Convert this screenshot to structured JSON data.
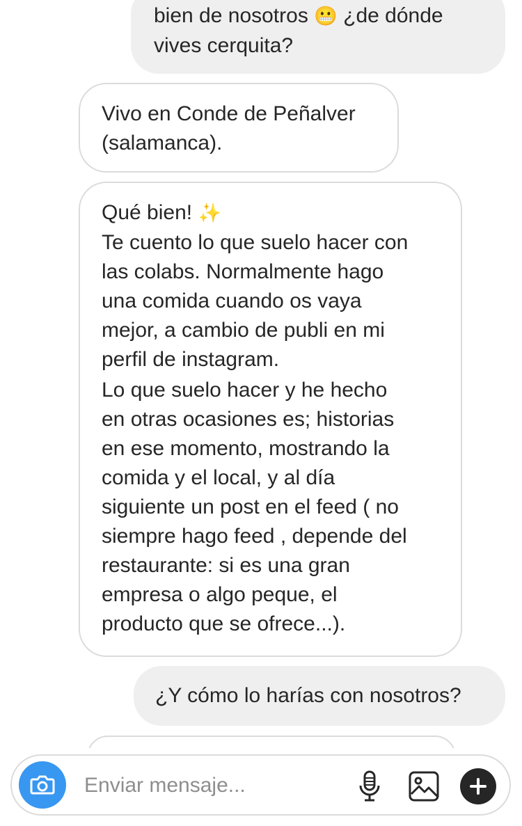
{
  "messages": [
    {
      "from": "sent",
      "line1": "bien de nosotros",
      "emoji1": "😬",
      "line1_end": "¿de dónde",
      "line2": "vives cerquita?"
    },
    {
      "from": "received",
      "text": "Vivo en Conde de Peñalver\n(salamanca)."
    },
    {
      "from": "received",
      "greeting": "Qué bien!",
      "greeting_emoji": "✨",
      "paragraph1": "Te cuento lo que suelo hacer con\nlas colabs. Normalmente hago\nuna comida cuando os vaya\nmejor, a cambio de publi en mi\nperfil de instagram.",
      "paragraph2": "Lo que suelo hacer y he hecho\nen otras ocasiones es;  historias\nen ese momento, mostrando la\ncomida y el local, y al día\nsiguiente un post en el feed ( no\nsiempre hago feed , depende del\nrestaurante: si es una gran\nempresa o algo peque, el\nproducto que se ofrece...)."
    },
    {
      "from": "sent",
      "text": "¿Y cómo lo harías con nosotros?"
    }
  ],
  "composer": {
    "placeholder": "Enviar mensaje...",
    "icons": [
      "camera-icon",
      "microphone-icon",
      "gallery-icon",
      "plus-icon"
    ],
    "accent_color": "#3897f0"
  }
}
